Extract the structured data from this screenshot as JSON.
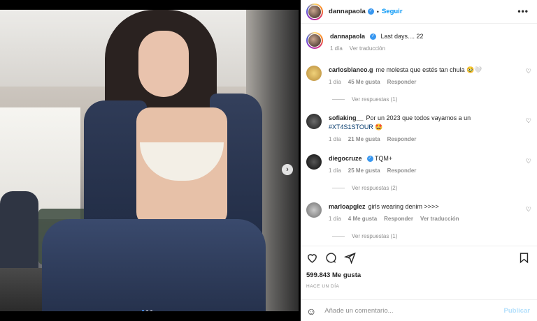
{
  "post": {
    "username": "dannapaola",
    "follow_label": "Seguir",
    "more_label": "•••",
    "caption": "Last days.... 22",
    "caption_time": "1 día",
    "translate_label": "Ver traducción",
    "likes": "599.843 Me gusta",
    "timestamp": "HACE UN DÍA",
    "comment_placeholder": "Añade un comentario...",
    "post_label": "Publicar",
    "carousel_next": "›"
  },
  "comments": [
    {
      "user": "carlosblanco.g",
      "text": "me molesta que estés tan chula 🥹🤍",
      "time": "1 día",
      "likes": "45 Me gusta",
      "reply": "Responder",
      "view_replies": "Ver respuestas (1)"
    },
    {
      "user": "sofiaking__",
      "text": "Por un 2023 que todos vayamos a un",
      "hashtag": "#XT4S1STOUR",
      "emoji": "🤩",
      "time": "1 día",
      "likes": "21 Me gusta",
      "reply": "Responder"
    },
    {
      "user": "diegocruze",
      "text": "TQM+",
      "time": "1 día",
      "likes": "25 Me gusta",
      "reply": "Responder",
      "view_replies": "Ver respuestas (2)"
    },
    {
      "user": "marloapglez",
      "text": "girls wearing denim >>>>",
      "time": "1 día",
      "likes": "4 Me gusta",
      "reply": "Responder",
      "translate": "Ver traducción",
      "view_replies": "Ver respuestas (1)"
    }
  ],
  "colors": {
    "accent": "#0095f6",
    "verified": "#3897f0",
    "muted": "#8e8e8e"
  }
}
